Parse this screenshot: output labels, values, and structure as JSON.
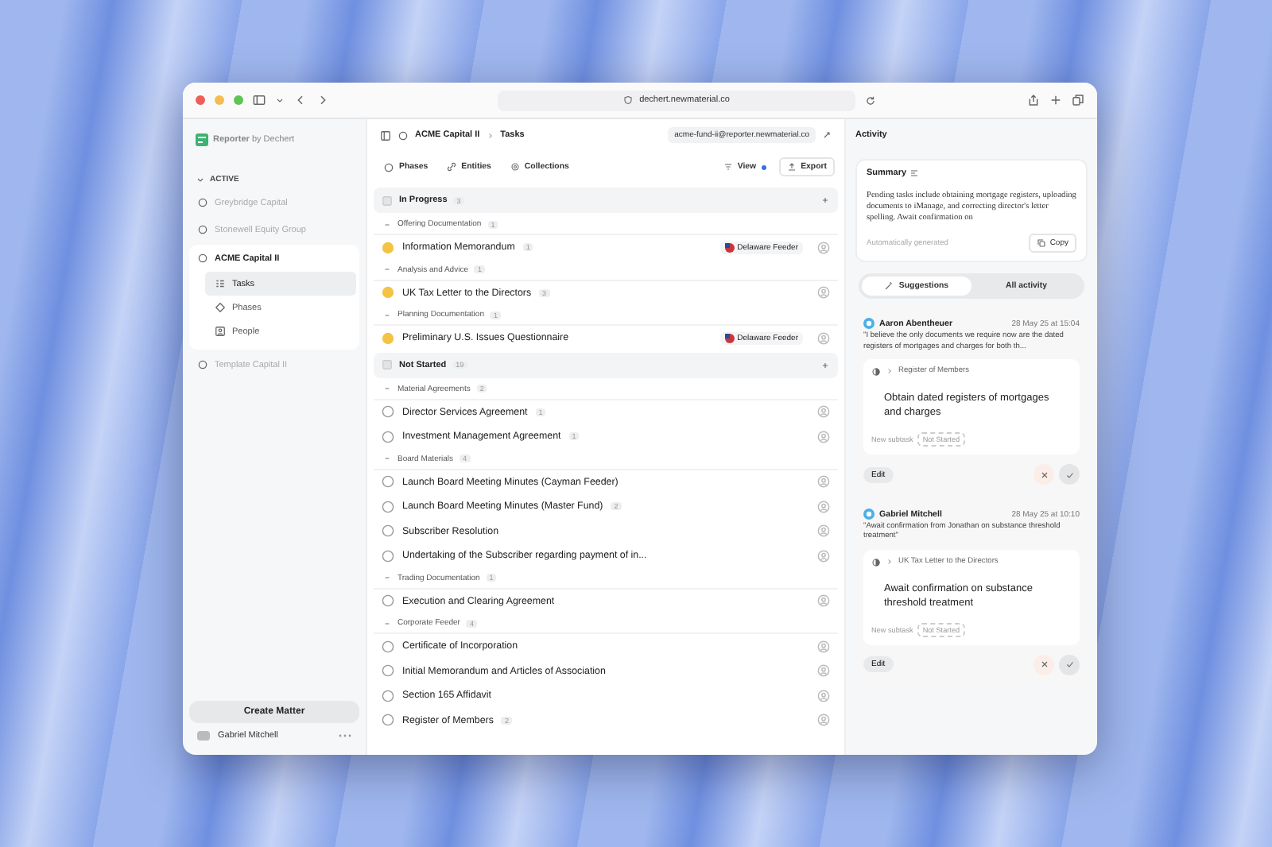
{
  "browser": {
    "url": "dechert.newmaterial.co"
  },
  "sidebar": {
    "brand": "Reporter",
    "brand_suffix": "by Dechert",
    "section": "ACTIVE",
    "expanded": true,
    "matters": [
      {
        "name": "Greybridge Capital",
        "selected": false
      },
      {
        "name": "Stonewell Equity Group",
        "selected": false
      },
      {
        "name": "ACME Capital II",
        "selected": true,
        "children": [
          {
            "label": "Tasks",
            "kind": "tasks",
            "selected": true
          },
          {
            "label": "Phases",
            "kind": "phases",
            "selected": false
          },
          {
            "label": "People",
            "kind": "people",
            "selected": false
          }
        ]
      },
      {
        "name": "Template Capital II",
        "selected": false
      }
    ],
    "create_button": "Create Matter",
    "user": "Gabriel Mitchell"
  },
  "main": {
    "breadcrumb": [
      "ACME Capital II",
      "Tasks"
    ],
    "email": "acme-fund-ii@reporter.newmaterial.co",
    "filters": [
      "Phases",
      "Entities",
      "Collections"
    ],
    "view": "View",
    "export": "Export",
    "sections": [
      {
        "title": "In Progress",
        "count": "3",
        "kind": "in_progress",
        "groups": [
          {
            "name": "Offering Documentation",
            "count": "1",
            "tasks": [
              {
                "title": "Information Memorandum",
                "count": "1",
                "entity": "Delaware Feeder"
              }
            ]
          },
          {
            "name": "Analysis and Advice",
            "count": "1",
            "tasks": [
              {
                "title": "UK Tax Letter to the Directors",
                "count": "3"
              }
            ]
          },
          {
            "name": "Planning Documentation",
            "count": "1",
            "tasks": [
              {
                "title": "Preliminary U.S. Issues Questionnaire",
                "entity": "Delaware Feeder"
              }
            ]
          }
        ]
      },
      {
        "title": "Not Started",
        "count": "19",
        "kind": "not_started",
        "groups": [
          {
            "name": "Material Agreements",
            "count": "2",
            "tasks": [
              {
                "title": "Director Services Agreement",
                "count": "1"
              },
              {
                "title": "Investment Management Agreement",
                "count": "1"
              }
            ]
          },
          {
            "name": "Board Materials",
            "count": "4",
            "tasks": [
              {
                "title": "Launch Board Meeting Minutes (Cayman Feeder)"
              },
              {
                "title": "Launch Board Meeting Minutes (Master Fund)",
                "count": "2"
              },
              {
                "title": "Subscriber Resolution"
              },
              {
                "title": "Undertaking of the Subscriber regarding payment of in..."
              }
            ]
          },
          {
            "name": "Trading Documentation",
            "count": "1",
            "tasks": [
              {
                "title": "Execution and Clearing Agreement"
              }
            ]
          },
          {
            "name": "Corporate Feeder",
            "count": "4",
            "tasks": [
              {
                "title": "Certificate of Incorporation"
              },
              {
                "title": "Initial Memorandum and Articles of Association"
              },
              {
                "title": "Section 165 Affidavit"
              },
              {
                "title": "Register of Members",
                "count": "2"
              }
            ]
          }
        ]
      }
    ]
  },
  "activity": {
    "title": "Activity",
    "summary": {
      "title": "Summary",
      "text": "Pending tasks include obtaining mortgage registers, uploading documents to iManage, and correcting director's letter spelling. Await confirmation on",
      "footer": "Automatically generated",
      "copy": "Copy"
    },
    "tabs": [
      {
        "label": "Suggestions",
        "selected": true
      },
      {
        "label": "All activity",
        "selected": false
      }
    ],
    "cards": [
      {
        "author": "Aaron Abentheuer",
        "time": "28 May 25 at 15:04",
        "quote": "\"I believe the only documents we require now are the dated registers of mortgages and charges for both th...",
        "task": "Register of Members",
        "suggestion": "Obtain dated registers of mortgages and charges",
        "subtask_label": "New subtask",
        "status": "Not Started",
        "edit": "Edit"
      },
      {
        "author": "Gabriel Mitchell",
        "time": "28 May 25 at 10:10",
        "quote": "\"Await confirmation from Jonathan on substance threshold treatment\"",
        "task": "UK Tax Letter to the Directors",
        "suggestion": "Await confirmation on substance threshold treatment",
        "subtask_label": "New subtask",
        "status": "Not Started",
        "edit": "Edit"
      }
    ]
  }
}
